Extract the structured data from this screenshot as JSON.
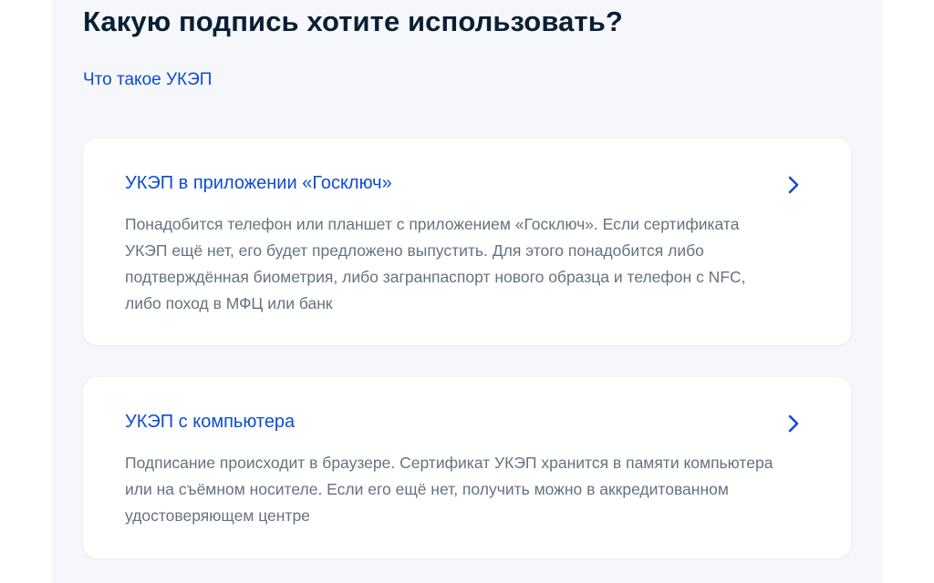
{
  "page": {
    "title": "Какую подпись хотите использовать?",
    "help_link": "Что такое УКЭП"
  },
  "options": [
    {
      "title": "УКЭП в приложении «Госключ»",
      "description": "Понадобится телефон или планшет с приложением «Госключ». Если сертификата УКЭП ещё нет, его будет предложено выпустить. Для этого понадобится либо подтверждённая биометрия, либо загранпаспорт нового образца и телефон с NFC, либо поход в МФЦ или банк",
      "icon": "chevron-right-icon"
    },
    {
      "title": "УКЭП с компьютера",
      "description": "Подписание происходит в браузере. Сертификат УКЭП хранится в памяти компьютера или на съёмном носителе. Если его ещё нет, получить можно в аккредитованном удостоверяющем центре",
      "icon": "chevron-right-icon"
    }
  ],
  "colors": {
    "heading": "#0b1f33",
    "link": "#0d4cd3",
    "body_text": "#66727f",
    "page_background": "#f5f7fb",
    "card_background": "#ffffff"
  }
}
